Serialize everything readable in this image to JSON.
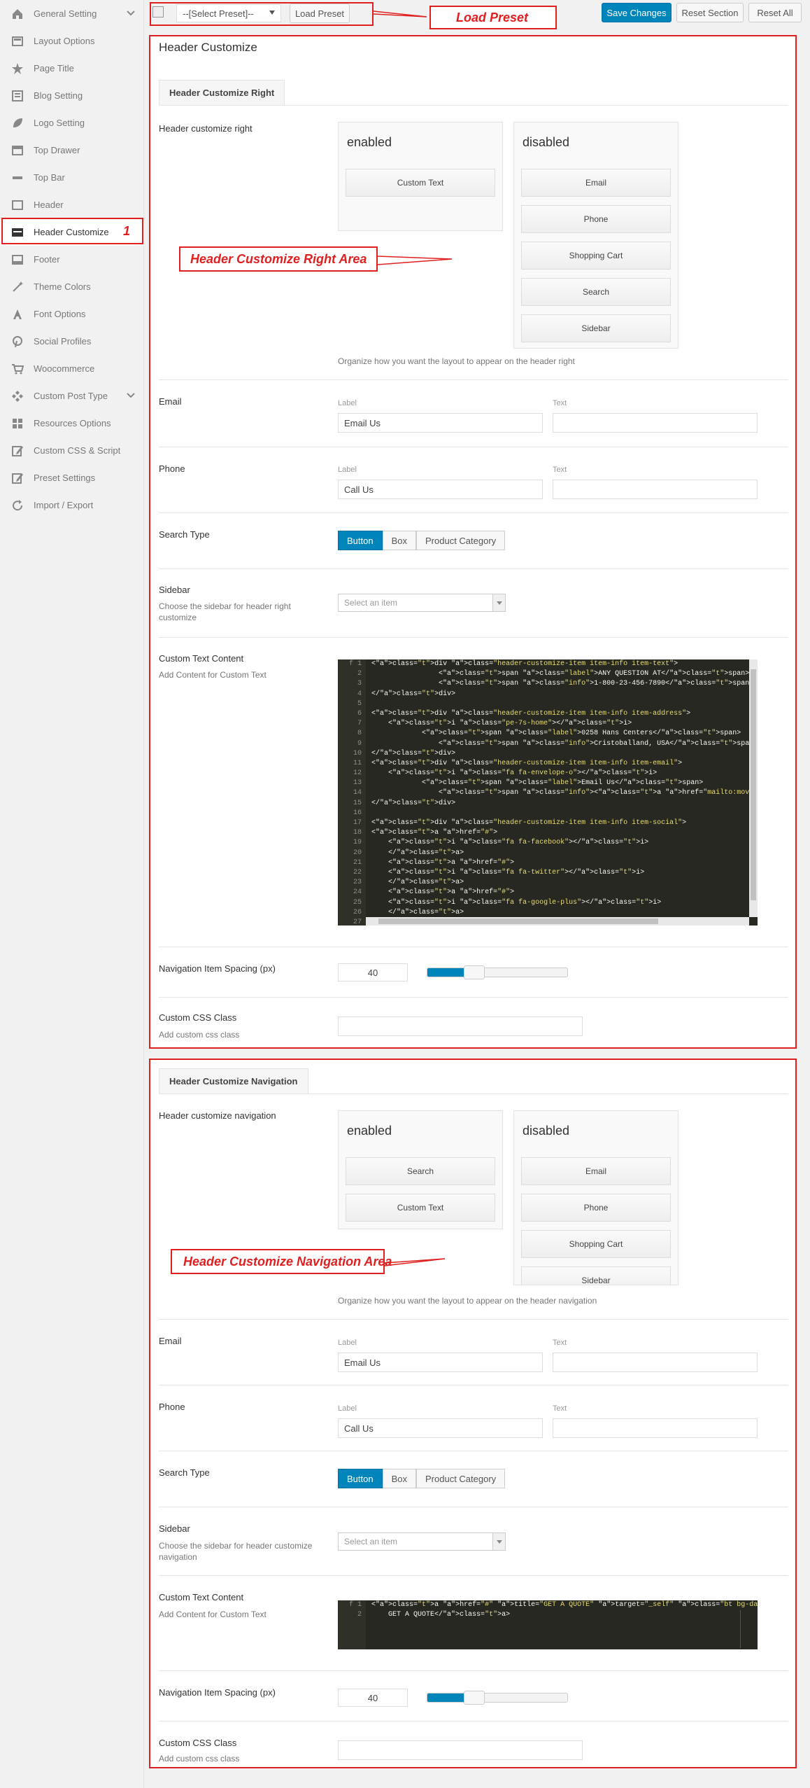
{
  "sidebar": {
    "items": [
      {
        "label": "General Setting",
        "icon": "home-icon",
        "chevron": true
      },
      {
        "label": "Layout Options",
        "icon": "layout-icon"
      },
      {
        "label": "Page Title",
        "icon": "star-icon"
      },
      {
        "label": "Blog Setting",
        "icon": "blog-icon"
      },
      {
        "label": "Logo Setting",
        "icon": "leaf-icon"
      },
      {
        "label": "Top Drawer",
        "icon": "drawer-icon"
      },
      {
        "label": "Top Bar",
        "icon": "minus-icon"
      },
      {
        "label": "Header",
        "icon": "header-icon"
      },
      {
        "label": "Header Customize",
        "icon": "card-icon",
        "active": true
      },
      {
        "label": "Footer",
        "icon": "footer-icon"
      },
      {
        "label": "Theme Colors",
        "icon": "wand-icon"
      },
      {
        "label": "Font Options",
        "icon": "font-icon"
      },
      {
        "label": "Social Profiles",
        "icon": "pinterest-icon"
      },
      {
        "label": "Woocommerce",
        "icon": "cart-icon"
      },
      {
        "label": "Custom Post Type",
        "icon": "puzzle-icon",
        "chevron": true
      },
      {
        "label": "Resources Options",
        "icon": "grid-icon"
      },
      {
        "label": "Custom CSS & Script",
        "icon": "edit-icon"
      },
      {
        "label": "Preset Settings",
        "icon": "edit-icon"
      },
      {
        "label": "Import / Export",
        "icon": "refresh-icon"
      }
    ]
  },
  "annotations": {
    "load_preset": "Load Preset",
    "number_one": "1",
    "right_area": "Header Customize Right Area",
    "nav_area": "Header Customize Navigation Area"
  },
  "toolbar": {
    "preset_select": "--[Select Preset]--",
    "load_preset": "Load Preset",
    "save": "Save Changes",
    "reset_section": "Reset Section",
    "reset_all": "Reset All"
  },
  "section": {
    "title": "Header Customize"
  },
  "right": {
    "tab": "Header Customize Right",
    "sorter_title": "Header customize right",
    "enabled_title": "enabled",
    "disabled_title": "disabled",
    "enabled_items": [
      "Custom Text"
    ],
    "disabled_items": [
      "Email",
      "Phone",
      "Shopping Cart",
      "Search",
      "Sidebar"
    ],
    "sorter_desc": "Organize how you want the layout to appear on the header right",
    "email_title": "Email",
    "label_caption": "Label",
    "text_caption": "Text",
    "email_label_value": "Email Us",
    "phone_title": "Phone",
    "phone_label_value": "Call Us",
    "search_title": "Search Type",
    "search_options": [
      "Button",
      "Box",
      "Product Category"
    ],
    "sidebar_title": "Sidebar",
    "sidebar_desc": "Choose the sidebar for header right customize",
    "sidebar_placeholder": "Select an item",
    "custom_text_title": "Custom Text Content",
    "custom_text_desc": "Add Content for Custom Text",
    "spacing_title": "Navigation Item Spacing (px)",
    "spacing_value": "40",
    "spacing_fraction": 0.26,
    "css_title": "Custom CSS Class",
    "css_desc": "Add custom css class"
  },
  "nav": {
    "tab": "Header Customize Navigation",
    "sorter_title": "Header customize navigation",
    "enabled_title": "enabled",
    "disabled_title": "disabled",
    "enabled_items": [
      "Search",
      "Custom Text"
    ],
    "disabled_items": [
      "Email",
      "Phone",
      "Shopping Cart",
      "Sidebar"
    ],
    "sorter_desc": "Organize how you want the layout to appear on the header navigation",
    "email_title": "Email",
    "label_caption": "Label",
    "text_caption": "Text",
    "email_label_value": "Email Us",
    "phone_title": "Phone",
    "phone_label_value": "Call Us",
    "search_title": "Search Type",
    "search_options": [
      "Button",
      "Box",
      "Product Category"
    ],
    "sidebar_title": "Sidebar",
    "sidebar_desc": "Choose the sidebar for header customize navigation",
    "sidebar_placeholder": "Select an item",
    "custom_text_title": "Custom Text Content",
    "custom_text_desc": "Add Content for Custom Text",
    "spacing_title": "Navigation Item Spacing (px)",
    "spacing_value": "40",
    "spacing_fraction": 0.26,
    "css_title": "Custom CSS Class",
    "css_desc": "Add custom css class"
  },
  "code_right": [
    "<div class=\"header-customize-item item-info item-text\">",
    "                <span class=\"label\">ANY QUESTION AT</span>",
    "                <span class=\"info\">1-800-23-456-7890</span>",
    "</div>",
    "",
    "<div class=\"header-customize-item item-info item-address\">",
    "    <i class=\"pe-7s-home\"></i>",
    "            <span class=\"label\">0258 Hans Centers</span>",
    "                <span class=\"info\">Cristoballand, USA</span>",
    "</div>",
    "<div class=\"header-customize-item item-info item-email\">",
    "    <i class=\"fa fa-envelope-o\"></i>",
    "            <span class=\"label\">Email Us</span>",
    "                <span class=\"info\"><a href=\"mailto:moveco@support.com\">moveco@sup",
    "</div>",
    "",
    "<div class=\"header-customize-item item-info item-social\">",
    "<a href=\"#\">",
    "    <i class=\"fa fa-facebook\"></i>",
    "    </a>",
    "    <a href=\"#\">",
    "    <i class=\"fa fa-twitter\"></i>",
    "    </a>",
    "    <a href=\"#\">",
    "    <i class=\"fa fa-google-plus\"></i>",
    "    </a>",
    ""
  ],
  "code_nav": [
    "<a href=\"#\" title=\"GET A QUOTE\" target=\"_self\" class=\"bt bg-dark  \">",
    "    GET A QUOTE</a>"
  ],
  "colors": {
    "accent": "#0085ba",
    "annotation": "#e02020",
    "editor_bg": "#272822"
  }
}
